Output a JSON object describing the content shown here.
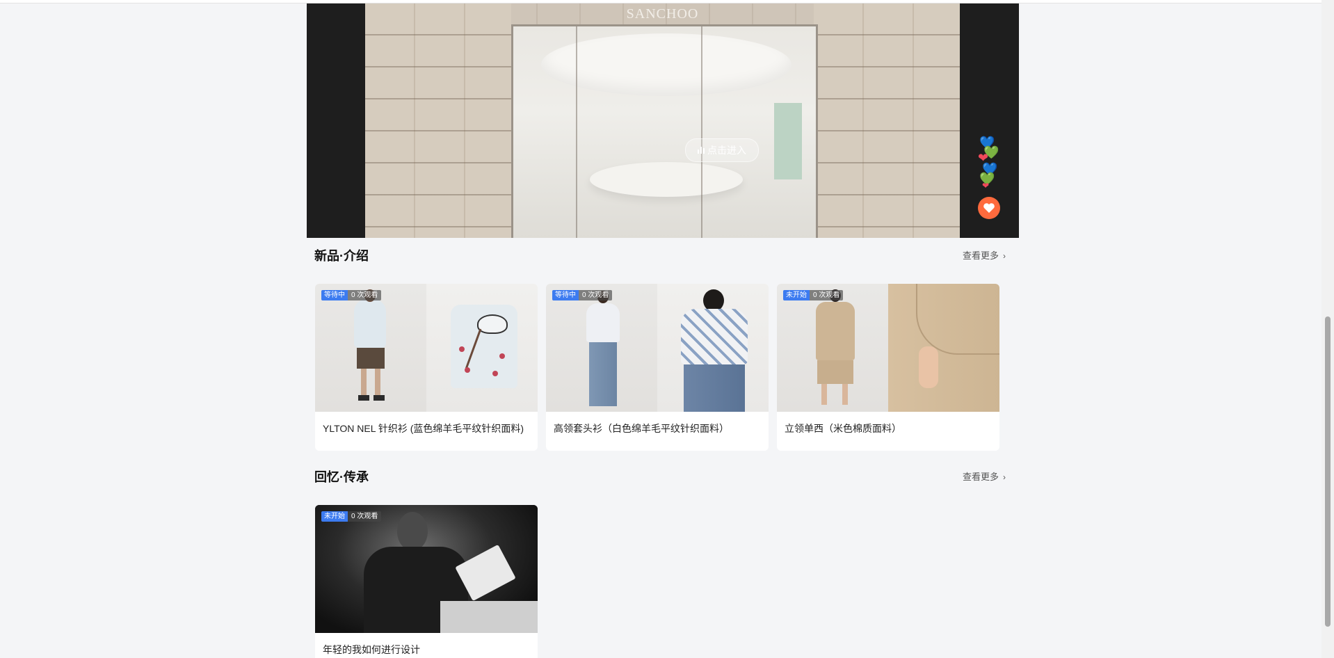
{
  "hero": {
    "brand": "SANCHOO",
    "enter_label": "点击进入",
    "float_hearts": [
      "💙",
      "💚",
      "❤",
      "💙",
      "💚",
      "❤"
    ],
    "like_icon": "heart-icon"
  },
  "sections": [
    {
      "title": "新品·介绍",
      "more_label": "查看更多",
      "items": [
        {
          "status": "等待中",
          "views": "0 次观看",
          "caption": "YLTON NEL 针织衫 (蓝色绵羊毛平纹针织面料)"
        },
        {
          "status": "等待中",
          "views": "0 次观看",
          "caption": "高领套头衫（白色绵羊毛平纹针织面料）"
        },
        {
          "status": "未开始",
          "views": "0 次观看",
          "caption": "立领单西（米色棉质面料）"
        }
      ]
    },
    {
      "title": "回忆·传承",
      "more_label": "查看更多",
      "items": [
        {
          "status": "未开始",
          "views": "0 次观看",
          "caption": "年轻的我如何进行设计"
        }
      ]
    }
  ],
  "colors": {
    "accent": "#3c7bf0",
    "like": "#ff6a3d",
    "page_bg": "#f4f5f7"
  }
}
